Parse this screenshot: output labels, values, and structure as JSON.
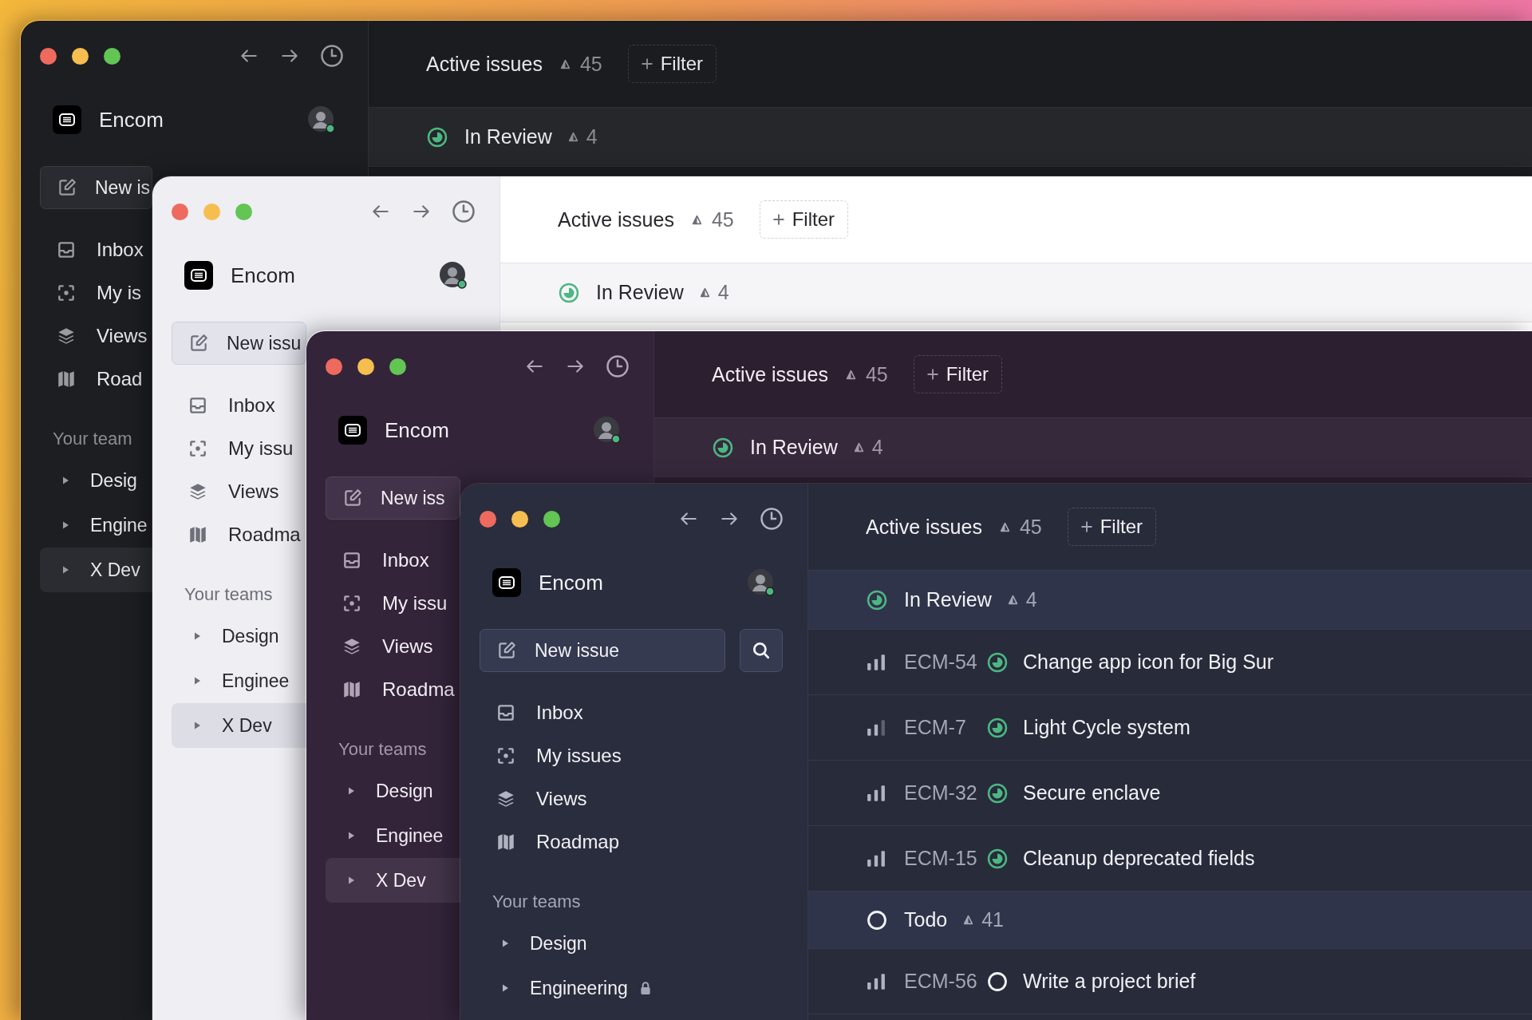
{
  "windows": [
    {
      "kind": "dark",
      "workspace": "Encom",
      "new_issue": "New is",
      "nav": [
        {
          "kind": "inbox",
          "label": "Inbox"
        },
        {
          "kind": "focus",
          "label": "My is"
        },
        {
          "kind": "layers",
          "label": "Views"
        },
        {
          "kind": "map",
          "label": "Road"
        }
      ],
      "teams_heading": "Your team",
      "teams": [
        {
          "label": "Desig",
          "selected": false
        },
        {
          "label": "Engine",
          "selected": false
        },
        {
          "label": "X Dev",
          "selected": true
        }
      ],
      "header": {
        "title": "Active issues",
        "count": "45",
        "filter": "Filter"
      },
      "groups": [
        {
          "kind": "in_review",
          "label": "In Review",
          "count": "4"
        }
      ]
    },
    {
      "kind": "light",
      "workspace": "Encom",
      "new_issue": "New issu",
      "nav": [
        {
          "kind": "inbox",
          "label": "Inbox"
        },
        {
          "kind": "focus",
          "label": "My issu"
        },
        {
          "kind": "layers",
          "label": "Views"
        },
        {
          "kind": "map",
          "label": "Roadma"
        }
      ],
      "teams_heading": "Your teams",
      "teams": [
        {
          "label": "Design",
          "selected": false
        },
        {
          "label": "Enginee",
          "selected": false
        },
        {
          "label": "X Dev",
          "selected": true
        }
      ],
      "header": {
        "title": "Active issues",
        "count": "45",
        "filter": "Filter"
      },
      "groups": [
        {
          "kind": "in_review",
          "label": "In Review",
          "count": "4"
        }
      ]
    },
    {
      "kind": "purple",
      "workspace": "Encom",
      "new_issue": "New iss",
      "nav": [
        {
          "kind": "inbox",
          "label": "Inbox"
        },
        {
          "kind": "focus",
          "label": "My issu"
        },
        {
          "kind": "layers",
          "label": "Views"
        },
        {
          "kind": "map",
          "label": "Roadma"
        }
      ],
      "teams_heading": "Your teams",
      "teams": [
        {
          "label": "Design",
          "selected": false
        },
        {
          "label": "Enginee",
          "selected": false
        },
        {
          "label": "X Dev",
          "selected": true
        }
      ],
      "header": {
        "title": "Active issues",
        "count": "45",
        "filter": "Filter"
      },
      "groups": [
        {
          "kind": "in_review",
          "label": "In Review",
          "count": "4"
        }
      ]
    },
    {
      "kind": "navy",
      "workspace": "Encom",
      "new_issue": "New issue",
      "search_button": true,
      "nav": [
        {
          "kind": "inbox",
          "label": "Inbox"
        },
        {
          "kind": "focus",
          "label": "My issues"
        },
        {
          "kind": "layers",
          "label": "Views"
        },
        {
          "kind": "map",
          "label": "Roadmap"
        }
      ],
      "teams_heading": "Your teams",
      "teams": [
        {
          "label": "Design",
          "selected": false,
          "locked": false
        },
        {
          "label": "Engineering",
          "selected": false,
          "locked": true
        }
      ],
      "header": {
        "title": "Active issues",
        "count": "45",
        "filter": "Filter"
      },
      "groups": [
        {
          "kind": "in_review",
          "label": "In Review",
          "count": "4",
          "issues": [
            {
              "priority": {
                "kind": "high"
              },
              "id": "ECM-54",
              "status": {
                "kind": "in_review"
              },
              "title": "Change app icon for Big Sur"
            },
            {
              "priority": {
                "kind": "medium"
              },
              "id": "ECM-7",
              "status": {
                "kind": "in_review"
              },
              "title": "Light Cycle system"
            },
            {
              "priority": {
                "kind": "high"
              },
              "id": "ECM-32",
              "status": {
                "kind": "in_review"
              },
              "title": "Secure enclave"
            },
            {
              "priority": {
                "kind": "high"
              },
              "id": "ECM-15",
              "status": {
                "kind": "in_review"
              },
              "title": "Cleanup deprecated fields"
            }
          ]
        },
        {
          "kind": "todo",
          "label": "Todo",
          "count": "41",
          "issues": [
            {
              "priority": {
                "kind": "high"
              },
              "id": "ECM-56",
              "status": {
                "kind": "todo"
              },
              "title": "Write a project brief"
            }
          ]
        }
      ]
    }
  ]
}
